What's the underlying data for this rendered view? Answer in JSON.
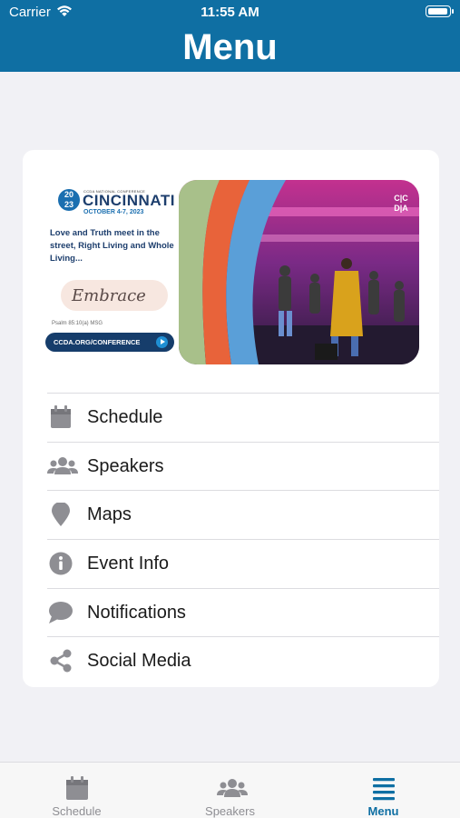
{
  "status_bar": {
    "carrier": "Carrier",
    "time": "11:55 AM"
  },
  "nav": {
    "title": "Menu"
  },
  "banner": {
    "year_top": "20",
    "year_bottom": "23",
    "conference_label": "CCDA NATIONAL CONFERENCE",
    "city": "CINCINNATI",
    "dates": "OCTOBER 4-7, 2023",
    "tagline": "Love and Truth meet in the street, Right Living and Whole Living...",
    "theme": "Embrace",
    "verse": "Psalm 85:10(a) MSG",
    "link_text": "CCDA.ORG/CONFERENCE",
    "logo_top": "C|C",
    "logo_bottom": "D|A"
  },
  "menu": {
    "items": [
      {
        "label": "Schedule",
        "icon": "calendar-icon"
      },
      {
        "label": "Speakers",
        "icon": "users-icon"
      },
      {
        "label": "Maps",
        "icon": "map-pin-icon"
      },
      {
        "label": "Event Info",
        "icon": "info-icon"
      },
      {
        "label": "Notifications",
        "icon": "chat-bubble-icon"
      },
      {
        "label": "Social Media",
        "icon": "share-icon"
      }
    ]
  },
  "tabs": [
    {
      "label": "Schedule",
      "icon": "calendar-icon",
      "active": false
    },
    {
      "label": "Speakers",
      "icon": "users-icon",
      "active": false
    },
    {
      "label": "Menu",
      "icon": "menu-lines-icon",
      "active": true
    }
  ],
  "colors": {
    "brand": "#0f6fa3",
    "icon_gray": "#8e8e93",
    "text": "#1a1a1a",
    "background": "#f1f1f5"
  }
}
